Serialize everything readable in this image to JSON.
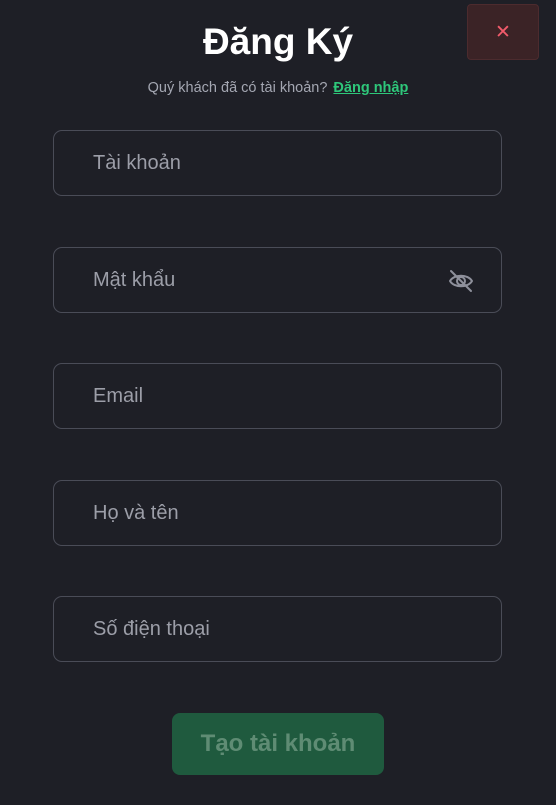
{
  "modal": {
    "title": "Đăng Ký",
    "close_icon": "close-icon",
    "subtitle_text": "Quý khách đã có tài khoản?",
    "login_link": "Đăng nhập"
  },
  "form": {
    "fields": [
      {
        "name": "username",
        "placeholder": "Tài khoản",
        "value": ""
      },
      {
        "name": "password",
        "placeholder": "Mật khẩu",
        "value": "",
        "icon": "eye-slash-icon"
      },
      {
        "name": "email",
        "placeholder": "Email",
        "value": ""
      },
      {
        "name": "fullname",
        "placeholder": "Họ và tên",
        "value": ""
      },
      {
        "name": "phone",
        "placeholder": "Số điện thoại",
        "value": ""
      }
    ],
    "submit_label": "Tạo tài khoản"
  },
  "colors": {
    "background": "#1e1f26",
    "accent_green": "#2ec77a",
    "submit_bg": "#1f5a3e",
    "close_bg": "#3b2326",
    "close_x": "#f25b6b"
  }
}
